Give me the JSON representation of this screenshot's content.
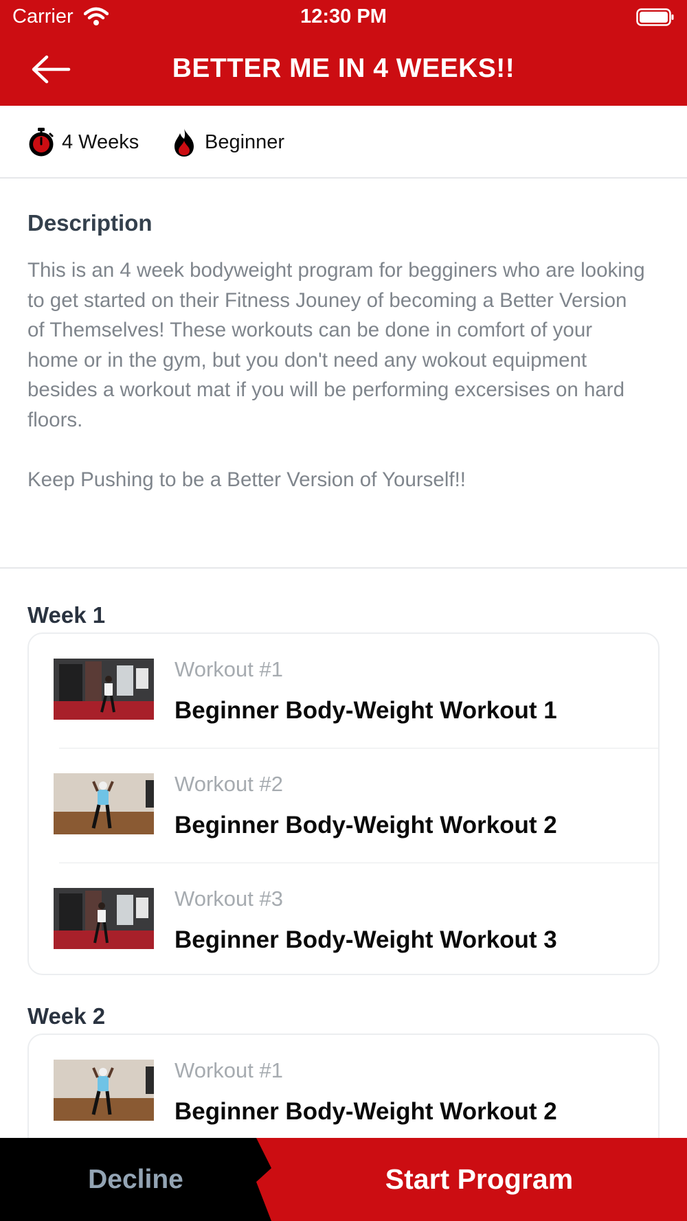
{
  "status_bar": {
    "carrier": "Carrier",
    "time": "12:30 PM"
  },
  "header": {
    "title": "BETTER ME IN 4 WEEKS!!"
  },
  "meta": {
    "duration": "4 Weeks",
    "level": "Beginner"
  },
  "description": {
    "heading": "Description",
    "paragraph1": "This is an 4 week bodyweight program for begginers who are looking to get started on their Fitness Jouney of becoming a Better Version of Themselves! These workouts can be done in comfort of your home or in the gym, but you don't need any wokout equipment besides a workout mat if you will be performing excersises on hard floors.",
    "paragraph2": "Keep Pushing to be a Better Version of Yourself!!"
  },
  "weeks": [
    {
      "title": "Week 1",
      "workouts": [
        {
          "label": "Workout #1",
          "name": "Beginner Body-Weight Workout 1"
        },
        {
          "label": "Workout #2",
          "name": "Beginner Body-Weight Workout 2"
        },
        {
          "label": "Workout #3",
          "name": "Beginner Body-Weight Workout 3"
        }
      ]
    },
    {
      "title": "Week 2",
      "workouts": [
        {
          "label": "Workout #1",
          "name": "Beginner Body-Weight Workout 2"
        }
      ]
    }
  ],
  "footer": {
    "decline_label": "Decline",
    "start_label": "Start Program"
  },
  "colors": {
    "brand_red": "#cc0d12",
    "footer_dark": "#000000"
  }
}
